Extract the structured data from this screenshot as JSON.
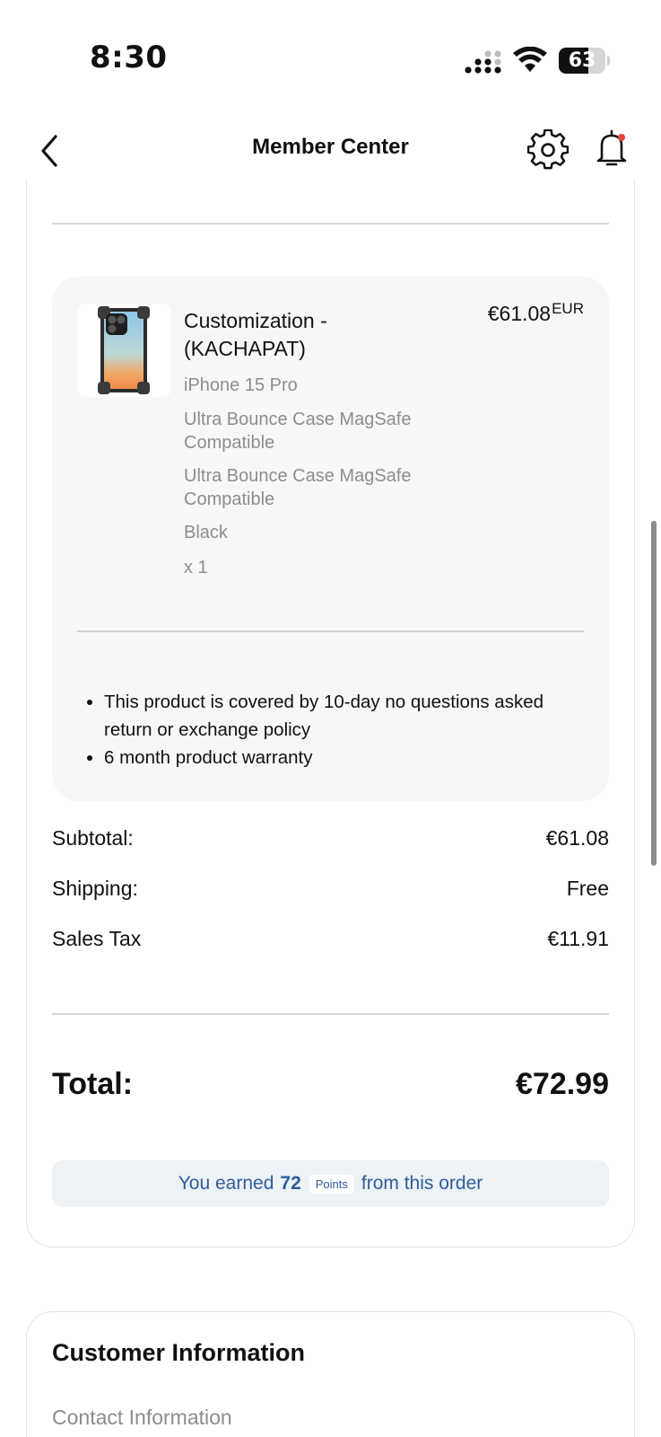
{
  "status_bar": {
    "time": "8:30",
    "battery_level": "63",
    "battery_fraction": 0.63,
    "icons": [
      "signal-icon",
      "wifi-icon",
      "battery-icon"
    ]
  },
  "nav": {
    "title": "Member Center",
    "icons": [
      "back-chevron-icon",
      "gear-icon",
      "bell-icon"
    ],
    "notification_dot_color": "#e5483b"
  },
  "order_item": {
    "title": "Customization - (KACHAPAT)",
    "price": "€61.08",
    "currency": "EUR",
    "details": [
      "iPhone 15 Pro",
      "Ultra Bounce Case MagSafe Compatible",
      "Ultra Bounce Case MagSafe Compatible",
      "Black",
      "x 1"
    ],
    "policies": [
      "This product is covered by 10-day no questions asked return or exchange policy",
      "6 month product warranty"
    ]
  },
  "summary": {
    "subtotal_label": "Subtotal:",
    "subtotal_value": "€61.08",
    "shipping_label": "Shipping:",
    "shipping_value": "Free",
    "tax_label": "Sales Tax",
    "tax_value": "€11.91",
    "total_label": "Total:",
    "total_value": "€72.99"
  },
  "points": {
    "prefix": "You earned",
    "amount": "72",
    "badge": "Points",
    "suffix": "from this order",
    "color": "#2f5b9a",
    "background": "#edf2f7"
  },
  "customer": {
    "title": "Customer Information",
    "contact_label": "Contact Information"
  }
}
